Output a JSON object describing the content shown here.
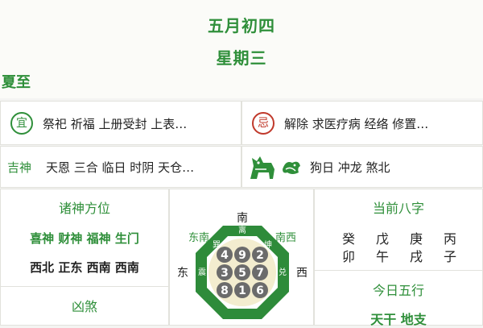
{
  "header": {
    "lunar_date": "五月初四",
    "weekday": "星期三",
    "solar_term": "夏至"
  },
  "yi": {
    "badge": "宜",
    "text": "祭祀 祈福 上册受封 上表…"
  },
  "ji": {
    "badge": "忌",
    "text": "解除 求医疗病 经络 修置…"
  },
  "jishen": {
    "label": "吉神",
    "text": "天恩 三合 临日 时阴 天仓…"
  },
  "chong": {
    "text": "狗日 冲龙 煞北",
    "zodiac_icons": [
      "dog-icon",
      "dragon-icon"
    ]
  },
  "gods_direction": {
    "title": "诸神方位",
    "names": "喜神 财神 福神 生门",
    "directions": "西北 正东 西南 西南"
  },
  "xiongsha": {
    "title": "凶煞"
  },
  "compass": {
    "south": "南",
    "southeast": "东南",
    "southwest": "南西",
    "east": "东",
    "west": "西",
    "trigram_top": "离",
    "trigram_left": "巽",
    "trigram_right": "坤",
    "trigram_east": "震",
    "trigram_west": "兑",
    "numbers": [
      "4",
      "9",
      "2",
      "3",
      "5",
      "7",
      "8",
      "1",
      "6"
    ]
  },
  "bazi": {
    "title": "当前八字",
    "stems": [
      "癸",
      "戊",
      "庚",
      "丙"
    ],
    "branches": [
      "卯",
      "午",
      "戌",
      "子"
    ]
  },
  "wuxing": {
    "title": "今日五行",
    "sub": "天干 地支"
  },
  "colors": {
    "accent": "#2f8f3a",
    "ji_red": "#c0392b",
    "compass_green": "#2e8b3a",
    "compass_inner": "#f3edcf"
  }
}
